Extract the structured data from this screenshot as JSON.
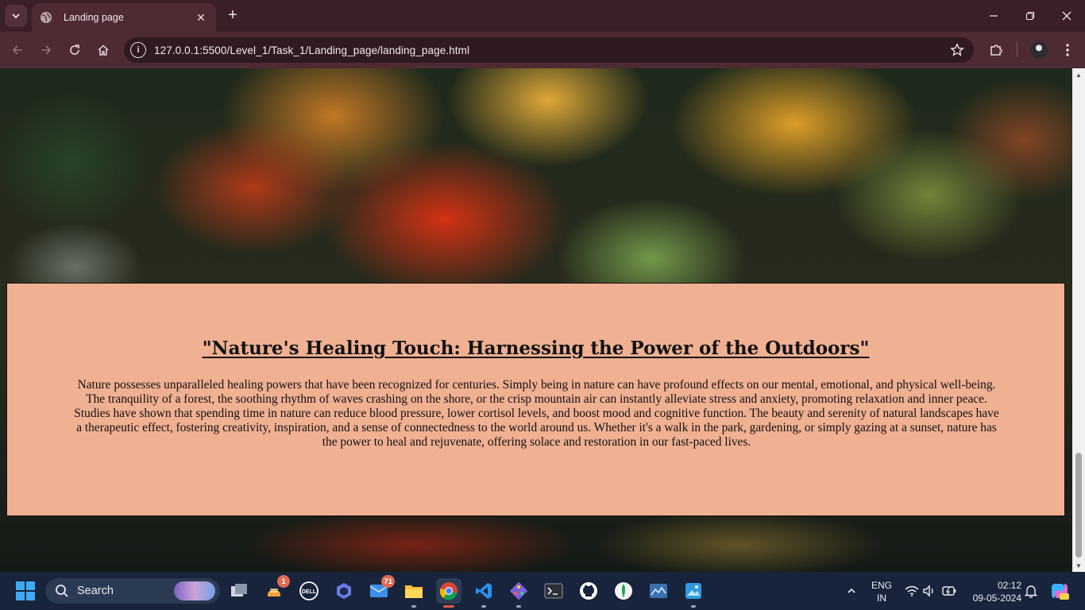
{
  "browser": {
    "tab_title": "Landing page",
    "url": "127.0.0.1:5500/Level_1/Task_1/Landing_page/landing_page.html"
  },
  "page": {
    "heading": "\"Nature's Healing Touch: Harnessing the Power of the Outdoors\"",
    "paragraph": "Nature possesses unparalleled healing powers that have been recognized for centuries. Simply being in nature can have profound effects on our mental, emotional, and physical well-being. The tranquility of a forest, the soothing rhythm of waves crashing on the shore, or the crisp mountain air can instantly alleviate stress and anxiety, promoting relaxation and inner peace. Studies have shown that spending time in nature can reduce blood pressure, lower cortisol levels, and boost mood and cognitive function. The beauty and serenity of natural landscapes have a therapeutic effect, fostering creativity, inspiration, and a sense of connectedness to the world around us. Whether it's a walk in the park, gardening, or simply gazing at a sunset, nature has the power to heal and rejuvenate, offering solace and restoration in our fast-paced lives.",
    "content_bg": "#f0b092"
  },
  "taskbar": {
    "search_label": "Search",
    "apps": [
      {
        "name": "task-view-icon",
        "badge": ""
      },
      {
        "name": "widgets-icon",
        "badge": "1"
      },
      {
        "name": "dell-icon",
        "badge": ""
      },
      {
        "name": "copilot-app-icon",
        "badge": ""
      },
      {
        "name": "mail-icon",
        "badge": "71"
      },
      {
        "name": "file-explorer-icon",
        "badge": ""
      },
      {
        "name": "chrome-icon",
        "badge": ""
      },
      {
        "name": "vscode-icon",
        "badge": ""
      },
      {
        "name": "git-icon",
        "badge": ""
      },
      {
        "name": "terminal-icon",
        "badge": ""
      },
      {
        "name": "github-icon",
        "badge": ""
      },
      {
        "name": "mongodb-icon",
        "badge": ""
      },
      {
        "name": "monitor-icon",
        "badge": ""
      },
      {
        "name": "photos-icon",
        "badge": ""
      }
    ],
    "lang_line1": "ENG",
    "lang_line2": "IN",
    "time": "02:12",
    "date": "09-05-2024"
  }
}
